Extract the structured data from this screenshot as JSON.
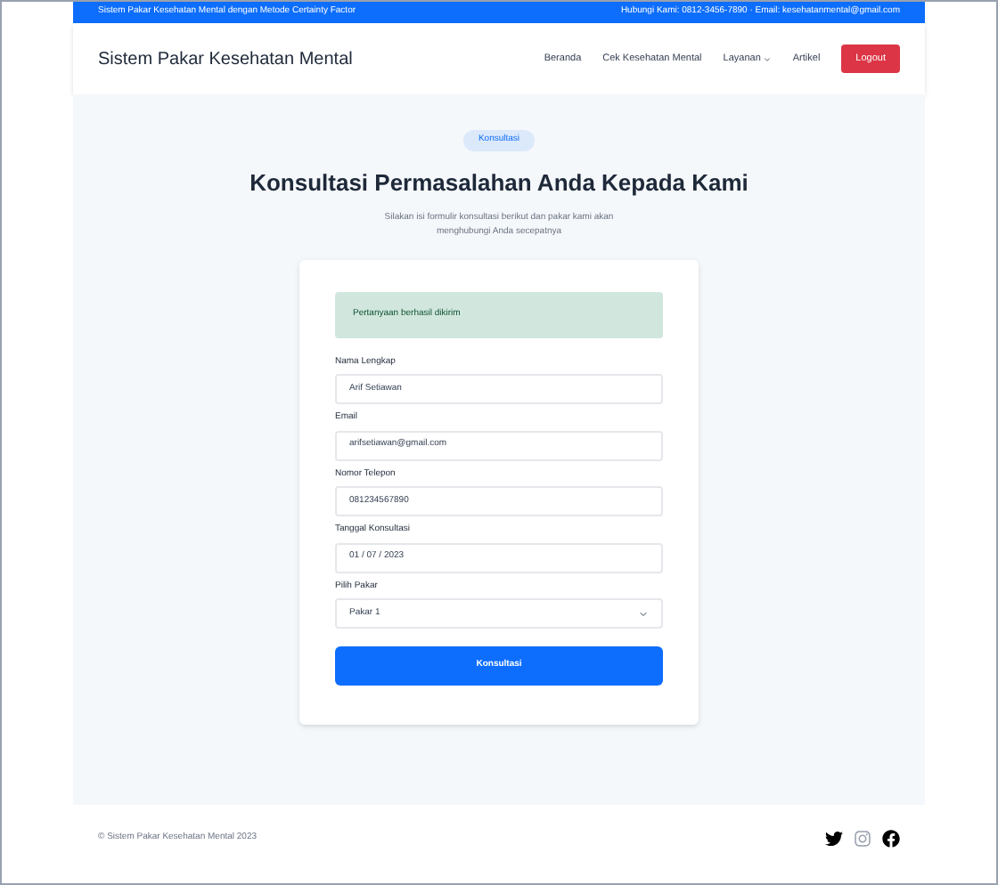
{
  "topbar": {
    "left": "Sistem Pakar Kesehatan Mental dengan Metode Certainty Factor",
    "right": "Hubungi Kami: 0812-3456-7890 · Email: kesehatanmental@gmail.com"
  },
  "navbar": {
    "brand": "Sistem Pakar Kesehatan Mental",
    "items": [
      {
        "label": "Beranda",
        "kind": "link"
      },
      {
        "label": "Cek Kesehatan Mental",
        "kind": "link"
      },
      {
        "label": "Layanan",
        "kind": "dropdown"
      },
      {
        "label": "Artikel",
        "kind": "link"
      },
      {
        "label": "Logout",
        "kind": "button"
      }
    ]
  },
  "hero": {
    "badge": "Konsultasi",
    "title": "Konsultasi Permasalahan Anda Kepada Kami",
    "subtitle": "Silakan isi formulir konsultasi berikut dan pakar kami akan menghubungi Anda secepatnya"
  },
  "form": {
    "alert": "Pertanyaan berhasil dikirim",
    "fields": [
      {
        "label": "Nama Lengkap",
        "value": "Arif Setiawan",
        "kind": "text"
      },
      {
        "label": "Email",
        "value": "arifsetiawan@gmail.com",
        "kind": "text"
      },
      {
        "label": "Nomor Telepon",
        "value": "081234567890",
        "kind": "text"
      },
      {
        "label": "Tanggal Konsultasi",
        "value": "01 / 07 / 2023",
        "kind": "text"
      },
      {
        "label": "Pilih Pakar",
        "value": "Pakar 1",
        "kind": "select"
      }
    ],
    "submit": "Konsultasi"
  },
  "footer": {
    "copyright": "© Sistem Pakar Kesehatan Mental 2023"
  }
}
